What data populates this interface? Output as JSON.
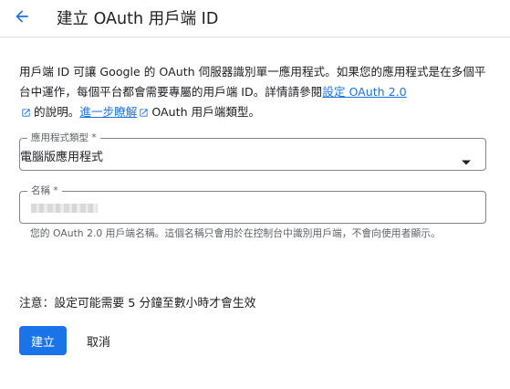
{
  "header": {
    "back_icon": "arrow-back-icon",
    "title": "建立 OAuth 用戶端 ID"
  },
  "description": {
    "text_1": "用戶端 ID 可讓 Google 的 OAuth 伺服器識別單一應用程式。如果您的應用程式是在多個平台中運作，每個平台都會需要專屬的用戶端 ID。詳情請參閱",
    "link_1": "設定 OAuth 2.0",
    "text_2": "的說明。",
    "link_2": "進一步瞭解",
    "text_3": "OAuth 用戶端類型。"
  },
  "app_type": {
    "label": "應用程式類型 *",
    "value": "電腦版應用程式"
  },
  "name_field": {
    "label": "名稱 *",
    "hint": "您的 OAuth 2.0 用戶端名稱。這個名稱只會用於在控制台中識別用戶端，不會向使用者顯示。"
  },
  "note": "注意：設定可能需要 5 分鐘至數小時才會生效",
  "buttons": {
    "create": "建立",
    "cancel": "取消"
  },
  "colors": {
    "accent": "#1a73e8",
    "text": "#202124",
    "secondary_text": "#5f6368",
    "border": "#80868b"
  }
}
